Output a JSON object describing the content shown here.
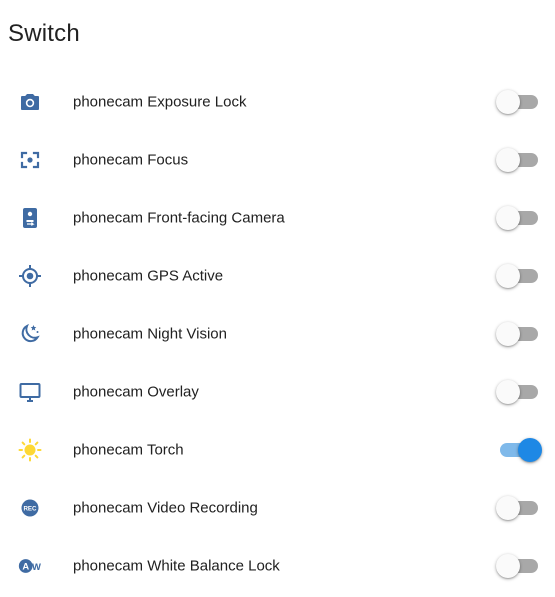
{
  "card": {
    "title": "Switch"
  },
  "colors": {
    "icon": "#3f6ba3",
    "icon_active": "#fdd835",
    "toggle_on": "#1e88e5",
    "toggle_off_track": "#9e9e9e",
    "text": "#212121"
  },
  "entities": [
    {
      "icon": "camera-icon",
      "label": "phonecam Exposure Lock",
      "state": "off"
    },
    {
      "icon": "focus-icon",
      "label": "phonecam Focus",
      "state": "off"
    },
    {
      "icon": "front-camera-icon",
      "label": "phonecam Front-facing Camera",
      "state": "off"
    },
    {
      "icon": "gps-crosshairs-icon",
      "label": "phonecam GPS Active",
      "state": "off"
    },
    {
      "icon": "night-vision-icon",
      "label": "phonecam Night Vision",
      "state": "off"
    },
    {
      "icon": "monitor-icon",
      "label": "phonecam Overlay",
      "state": "off"
    },
    {
      "icon": "torch-sun-icon",
      "label": "phonecam Torch",
      "state": "on"
    },
    {
      "icon": "record-rec-icon",
      "label": "phonecam Video Recording",
      "state": "off"
    },
    {
      "icon": "white-balance-auto-icon",
      "label": "phonecam White Balance Lock",
      "state": "off"
    }
  ]
}
